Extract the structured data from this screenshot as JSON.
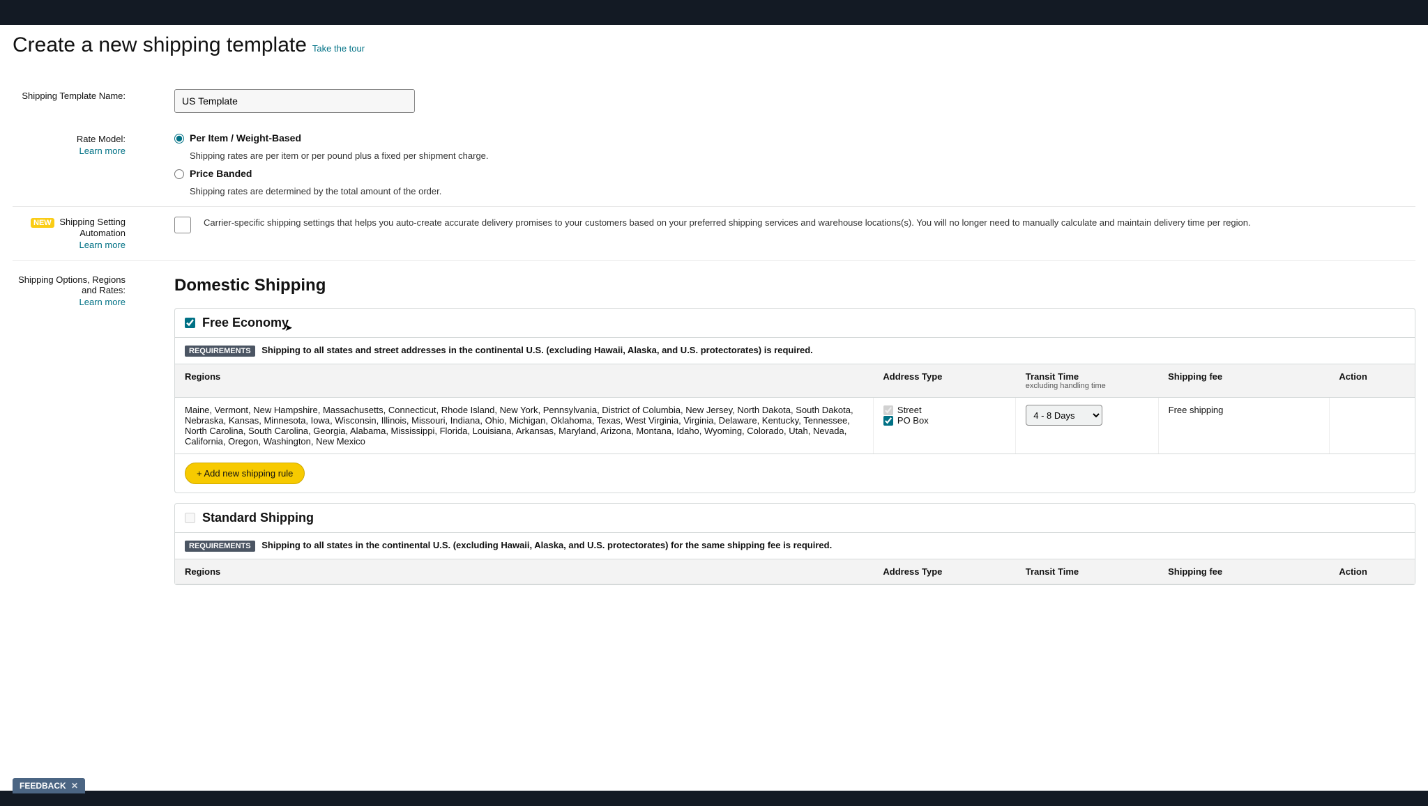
{
  "title": "Create a new shipping template",
  "take_tour": "Take the tour",
  "fields": {
    "template_name_label": "Shipping Template Name:",
    "template_name_value": "US Template",
    "rate_model_label": "Rate Model:",
    "learn_more": "Learn more",
    "rate_options": [
      {
        "title": "Per Item / Weight-Based",
        "desc": "Shipping rates are per item or per pound plus a fixed per shipment charge.",
        "checked": true
      },
      {
        "title": "Price Banded",
        "desc": "Shipping rates are determined by the total amount of the order.",
        "checked": false
      }
    ],
    "automation": {
      "new_badge": "NEW",
      "label": "Shipping Setting Automation",
      "desc": "Carrier-specific shipping settings that helps you auto-create accurate delivery promises to your customers based on your preferred shipping services and warehouse locations(s). You will no longer need to manually calculate and maintain delivery time per region."
    },
    "options_label": "Shipping Options, Regions and Rates:"
  },
  "domestic": {
    "heading": "Domestic Shipping",
    "free_economy": {
      "title": "Free Economy",
      "checked": true,
      "requirements_badge": "REQUIREMENTS",
      "requirements_text": "Shipping to all states and street addresses in the continental U.S. (excluding Hawaii, Alaska, and U.S. protectorates) is required.",
      "headers": {
        "regions": "Regions",
        "address_type": "Address Type",
        "transit_time": "Transit Time",
        "transit_sub": "excluding handling time",
        "shipping_fee": "Shipping fee",
        "action": "Action"
      },
      "row": {
        "regions": "Maine, Vermont, New Hampshire, Massachusetts, Connecticut, Rhode Island, New York, Pennsylvania, District of Columbia, New Jersey, North Dakota, South Dakota, Nebraska, Kansas, Minnesota, Iowa, Wisconsin, Illinois, Missouri, Indiana, Ohio, Michigan, Oklahoma, Texas, West Virginia, Virginia, Delaware, Kentucky, Tennessee, North Carolina, South Carolina, Georgia, Alabama, Mississippi, Florida, Louisiana, Arkansas, Maryland, Arizona, Montana, Idaho, Wyoming, Colorado, Utah, Nevada, California, Oregon, Washington, New Mexico",
        "street_label": "Street",
        "pobox_label": "PO Box",
        "transit_value": "4 - 8 Days",
        "fee": "Free shipping"
      },
      "add_rule": "+ Add new shipping rule"
    },
    "standard": {
      "title": "Standard Shipping",
      "checked": false,
      "requirements_badge": "REQUIREMENTS",
      "requirements_text": "Shipping to all states in the continental U.S. (excluding Hawaii, Alaska, and U.S. protectorates) for the same shipping fee is required.",
      "headers": {
        "regions": "Regions",
        "address_type": "Address Type",
        "transit_time": "Transit Time",
        "shipping_fee": "Shipping fee",
        "action": "Action"
      }
    }
  },
  "feedback": "FEEDBACK"
}
